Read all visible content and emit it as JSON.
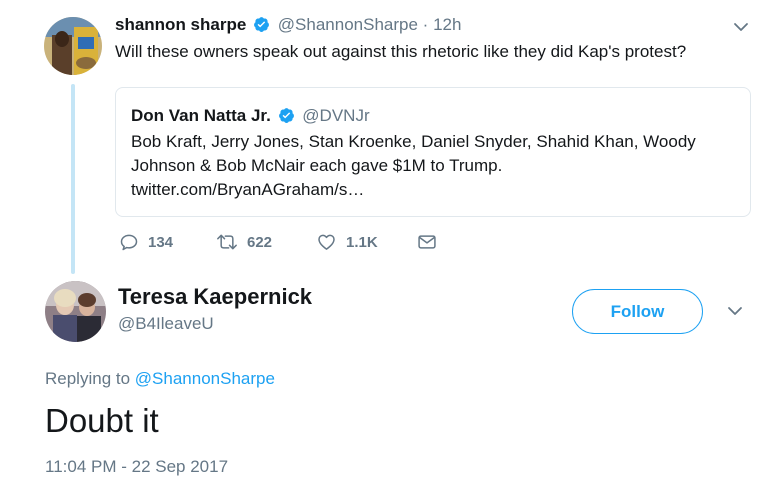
{
  "original_tweet": {
    "name": "shannon sharpe",
    "handle": "@ShannonSharpe",
    "separator": "·",
    "time": "12h",
    "text": "Will these owners speak out against this rhetoric like they did Kap's protest?",
    "verified": true,
    "quoted_tweet": {
      "name": "Don Van Natta Jr.",
      "handle": "@DVNJr",
      "verified": true,
      "text_lines": [
        "Bob Kraft, Jerry Jones, Stan Kroenke, Daniel Snyder, Shahid Khan, Woody",
        "Johnson & Bob McNair each gave $1M to Trump.",
        "twitter.com/BryanAGraham/s…"
      ]
    },
    "actions": {
      "reply_count": "134",
      "retweet_count": "622",
      "like_count": "1.1K"
    }
  },
  "main_tweet": {
    "name": "Teresa Kaepernick",
    "handle": "@B4IleaveU",
    "follow_label": "Follow",
    "replying_prefix": "Replying to",
    "replying_to": "@ShannonSharpe",
    "text": "Doubt it",
    "timestamp": "11:04 PM - 22 Sep 2017"
  },
  "icons": {
    "verified": "verified-badge-icon",
    "caret": "chevron-down-icon",
    "reply": "reply-icon",
    "retweet": "retweet-icon",
    "like": "heart-icon",
    "dm": "envelope-icon"
  },
  "colors": {
    "text_primary": "#14171a",
    "text_secondary": "#657786",
    "accent_blue": "#1da1f2",
    "thread_line": "#c4e5f6",
    "border": "#e1e8ed"
  }
}
